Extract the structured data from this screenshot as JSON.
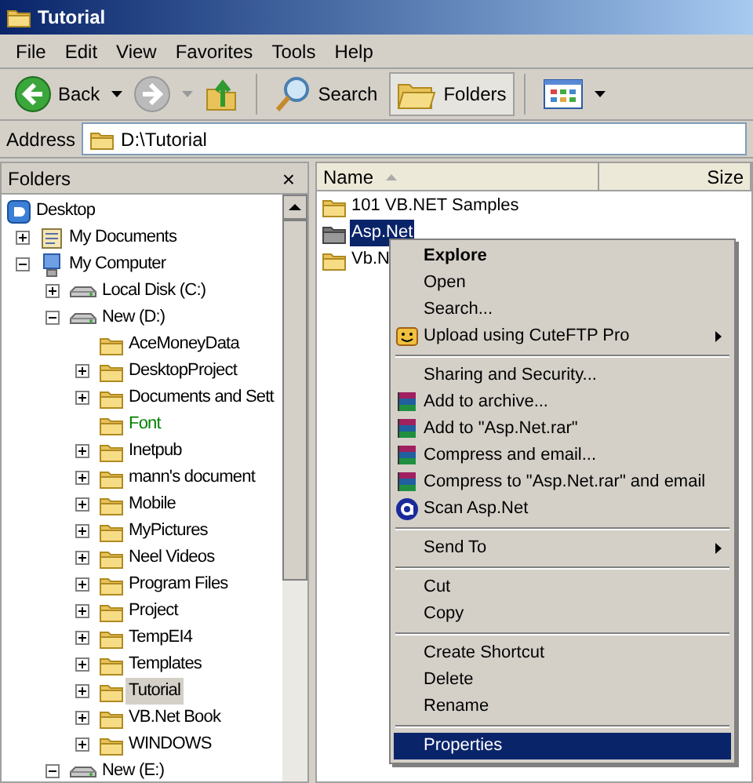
{
  "window": {
    "title": "Tutorial"
  },
  "menu_bar": [
    "File",
    "Edit",
    "View",
    "Favorites",
    "Tools",
    "Help"
  ],
  "toolbar": [
    {
      "kind": "back",
      "label": "Back",
      "pressed": false
    },
    {
      "kind": "forward",
      "pressed": false
    },
    {
      "kind": "up",
      "pressed": false
    },
    {
      "kind": "search",
      "label": "Search",
      "pressed": false
    },
    {
      "kind": "folders",
      "label": "Folders",
      "pressed": true
    },
    {
      "kind": "views",
      "pressed": false
    }
  ],
  "address": {
    "label": "Address",
    "value": "D:\\Tutorial"
  },
  "folders_pane": {
    "title": "Folders",
    "close": "×",
    "tree": [
      {
        "label": "Desktop",
        "kind": "desktop",
        "expandable": false,
        "selected": false,
        "children": [
          {
            "label": "My Documents",
            "kind": "documents",
            "expandable": true,
            "expanded": false,
            "selected": false
          },
          {
            "label": "My Computer",
            "kind": "computer",
            "expandable": true,
            "expanded": true,
            "selected": false,
            "children": [
              {
                "label": "Local Disk (C:)",
                "kind": "drive",
                "expandable": true,
                "expanded": false,
                "selected": false
              },
              {
                "label": "New (D:)",
                "kind": "drive",
                "expandable": true,
                "expanded": true,
                "selected": false,
                "children": [
                  {
                    "label": "AceMoneyData",
                    "kind": "folder",
                    "expandable": false,
                    "selected": false
                  },
                  {
                    "label": "DesktopProject",
                    "kind": "folder",
                    "expandable": true,
                    "expanded": false,
                    "selected": false
                  },
                  {
                    "label": "Documents and Sett",
                    "kind": "folder",
                    "expandable": true,
                    "expanded": false,
                    "selected": false
                  },
                  {
                    "label": "Font",
                    "kind": "folder",
                    "expandable": false,
                    "selected": false,
                    "color": "#008000"
                  },
                  {
                    "label": "Inetpub",
                    "kind": "folder",
                    "expandable": true,
                    "expanded": false,
                    "selected": false
                  },
                  {
                    "label": "mann's document",
                    "kind": "folder",
                    "expandable": true,
                    "expanded": false,
                    "selected": false
                  },
                  {
                    "label": "Mobile",
                    "kind": "folder",
                    "expandable": true,
                    "expanded": false,
                    "selected": false
                  },
                  {
                    "label": "MyPictures",
                    "kind": "folder",
                    "expandable": true,
                    "expanded": false,
                    "selected": false
                  },
                  {
                    "label": "Neel Videos",
                    "kind": "folder",
                    "expandable": true,
                    "expanded": false,
                    "selected": false
                  },
                  {
                    "label": "Program Files",
                    "kind": "folder",
                    "expandable": true,
                    "expanded": false,
                    "selected": false
                  },
                  {
                    "label": "Project",
                    "kind": "folder",
                    "expandable": true,
                    "expanded": false,
                    "selected": false
                  },
                  {
                    "label": "TempEI4",
                    "kind": "folder",
                    "expandable": true,
                    "expanded": false,
                    "selected": false
                  },
                  {
                    "label": "Templates",
                    "kind": "folder",
                    "expandable": true,
                    "expanded": false,
                    "selected": false
                  },
                  {
                    "label": "Tutorial",
                    "kind": "folder",
                    "expandable": true,
                    "expanded": false,
                    "selected": true
                  },
                  {
                    "label": "VB.Net Book",
                    "kind": "folder",
                    "expandable": true,
                    "expanded": false,
                    "selected": false
                  },
                  {
                    "label": "WINDOWS",
                    "kind": "folder",
                    "expandable": true,
                    "expanded": false,
                    "selected": false
                  }
                ]
              },
              {
                "label": "New (E:)",
                "kind": "drive",
                "expandable": true,
                "expanded": true,
                "selected": false
              }
            ]
          }
        ]
      }
    ]
  },
  "file_list": {
    "columns": [
      {
        "label": "Name",
        "sorted": true
      },
      {
        "label": "Size",
        "sorted": false
      }
    ],
    "rows": [
      {
        "name": "101 VB.NET Samples",
        "selected": false
      },
      {
        "name": "Asp.Net",
        "selected": true
      },
      {
        "name": "Vb.N",
        "selected": false
      }
    ]
  },
  "context_menu": [
    {
      "kind": "plain",
      "label": "Explore",
      "default": true,
      "submenu": false,
      "highlighted": false
    },
    {
      "kind": "plain",
      "label": "Open",
      "default": false,
      "submenu": false,
      "highlighted": false
    },
    {
      "kind": "plain",
      "label": "Search...",
      "default": false,
      "submenu": false,
      "highlighted": false
    },
    {
      "kind": "ftp",
      "label": "Upload using CuteFTP Pro",
      "default": false,
      "submenu": true,
      "highlighted": false
    },
    {
      "kind": "separator"
    },
    {
      "kind": "plain",
      "label": "Sharing and Security...",
      "default": false,
      "submenu": false,
      "highlighted": false
    },
    {
      "kind": "archive",
      "label": "Add to archive...",
      "default": false,
      "submenu": false,
      "highlighted": false
    },
    {
      "kind": "archive",
      "label": "Add to \"Asp.Net.rar\"",
      "default": false,
      "submenu": false,
      "highlighted": false
    },
    {
      "kind": "archive",
      "label": "Compress and email...",
      "default": false,
      "submenu": false,
      "highlighted": false
    },
    {
      "kind": "archive",
      "label": "Compress to \"Asp.Net.rar\" and email",
      "default": false,
      "submenu": false,
      "highlighted": false
    },
    {
      "kind": "scan",
      "label": "Scan Asp.Net",
      "default": false,
      "submenu": false,
      "highlighted": false
    },
    {
      "kind": "separator"
    },
    {
      "kind": "plain",
      "label": "Send To",
      "default": false,
      "submenu": true,
      "highlighted": false
    },
    {
      "kind": "separator"
    },
    {
      "kind": "plain",
      "label": "Cut",
      "default": false,
      "submenu": false,
      "highlighted": false
    },
    {
      "kind": "plain",
      "label": "Copy",
      "default": false,
      "submenu": false,
      "highlighted": false
    },
    {
      "kind": "separator"
    },
    {
      "kind": "plain",
      "label": "Create Shortcut",
      "default": false,
      "submenu": false,
      "highlighted": false
    },
    {
      "kind": "plain",
      "label": "Delete",
      "default": false,
      "submenu": false,
      "highlighted": false
    },
    {
      "kind": "plain",
      "label": "Rename",
      "default": false,
      "submenu": false,
      "highlighted": false
    },
    {
      "kind": "separator"
    },
    {
      "kind": "plain",
      "label": "Properties",
      "default": false,
      "submenu": false,
      "highlighted": true
    }
  ]
}
